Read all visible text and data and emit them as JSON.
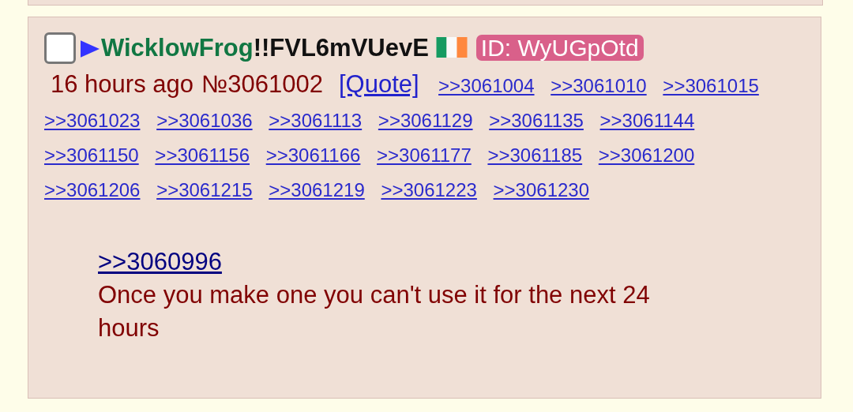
{
  "post": {
    "checked": false,
    "name": "WicklowFrog",
    "tripcode": "!!FVL6mVUevE",
    "poster_id": "ID: WyUGpOtd",
    "time": "16 hours ago",
    "number": "№3061002",
    "quote": "[Quote]",
    "backlinks": [
      ">>3061004",
      ">>3061010",
      ">>3061015",
      ">>3061023",
      ">>3061036",
      ">>3061113",
      ">>3061129",
      ">>3061135",
      ">>3061144",
      ">>3061150",
      ">>3061156",
      ">>3061166",
      ">>3061177",
      ">>3061185",
      ">>3061200",
      ">>3061206",
      ">>3061215",
      ">>3061219",
      ">>3061223",
      ">>3061230"
    ],
    "body": {
      "quotelink": ">>3060996",
      "text": "Once you make one you can't use it for the next 24 hours"
    }
  }
}
